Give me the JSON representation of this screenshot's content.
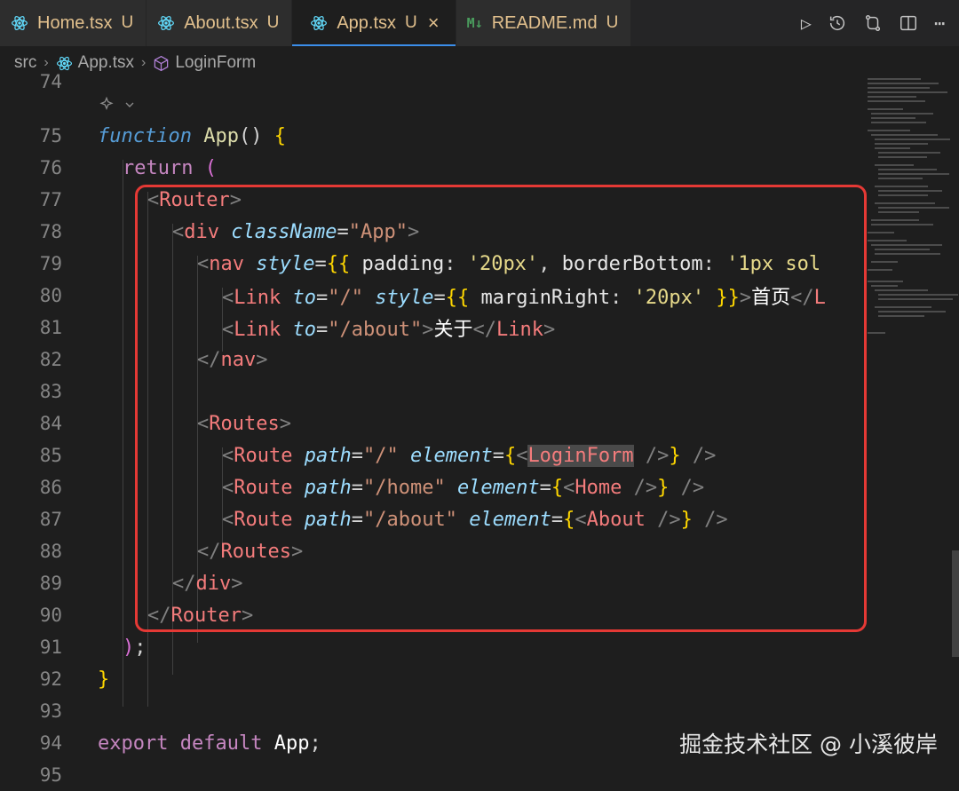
{
  "tabs": [
    {
      "name": "Home.tsx",
      "status": "U",
      "icon": "react-icon",
      "active": false
    },
    {
      "name": "About.tsx",
      "status": "U",
      "icon": "react-icon",
      "active": false
    },
    {
      "name": "App.tsx",
      "status": "U",
      "icon": "react-icon",
      "active": true,
      "close": "×"
    },
    {
      "name": "README.md",
      "status": "U",
      "icon": "markdown-icon",
      "active": false
    }
  ],
  "markdown_icon_text": "M↓",
  "toolbar": {
    "run": "▷",
    "timeline": "history-icon",
    "compare": "compare-icon",
    "split": "split-editor-icon",
    "more": "⋯"
  },
  "breadcrumb": {
    "folder": "src",
    "file": "App.tsx",
    "symbol": "LoginForm",
    "sep": "›"
  },
  "lines": {
    "top_partial": "74",
    "n75": "75",
    "n76": "76",
    "n77": "77",
    "n78": "78",
    "n79": "79",
    "n80": "80",
    "n81": "81",
    "n82": "82",
    "n83": "83",
    "n84": "84",
    "n85": "85",
    "n86": "86",
    "n87": "87",
    "n88": "88",
    "n89": "89",
    "n90": "90",
    "n91": "91",
    "n92": "92",
    "n93": "93",
    "n94": "94",
    "n95": "95"
  },
  "code": {
    "l75": {
      "kw": "function",
      "name": "App",
      "rest": "() ",
      "brace": "{"
    },
    "l76": {
      "kw": "return",
      "paren": "("
    },
    "l77": {
      "open": "<",
      "tag": "Router",
      "close": ">"
    },
    "l78": {
      "open": "<",
      "tag": "div",
      "attr": "className",
      "eq": "=",
      "val": "\"App\"",
      "close": ">"
    },
    "l79": {
      "open": "<",
      "tag": "nav",
      "attr": "style",
      "eq": "=",
      "brace": "{{",
      "k1": " padding",
      "c1": ": ",
      "v1": "'20px'",
      "comma": ", ",
      "k2": "borderBottom",
      "c2": ": ",
      "v2": "'1px sol"
    },
    "l80": {
      "open": "<",
      "tag": "Link",
      "attr1": "to",
      "eq": "=",
      "v1": "\"/\"",
      "attr2": "style",
      "brace": "{{",
      "k": " marginRight",
      "c": ": ",
      "v": "'20px'",
      "bclose": " }}",
      "gt": ">",
      "text": "首页",
      "endopen": "</",
      "endtag": "L"
    },
    "l81": {
      "open": "<",
      "tag": "Link",
      "attr": "to",
      "eq": "=",
      "v": "\"/about\"",
      "gt": ">",
      "text": "关于",
      "endopen": "</",
      "endtag": "Link",
      "endgt": ">"
    },
    "l82": {
      "open": "</",
      "tag": "nav",
      "close": ">"
    },
    "l84": {
      "open": "<",
      "tag": "Routes",
      "close": ">"
    },
    "l85": {
      "open": "<",
      "tag": "Route",
      "a1": "path",
      "eq": "=",
      "v1": "\"/\"",
      "a2": "element",
      "br": "{",
      "lt": "<",
      "comp": "LoginForm",
      "selfclose": " />",
      "brc": "}",
      "end": " />"
    },
    "l86": {
      "open": "<",
      "tag": "Route",
      "a1": "path",
      "eq": "=",
      "v1": "\"/home\"",
      "a2": "element",
      "br": "{",
      "lt": "<",
      "comp": "Home",
      "selfclose": " />",
      "brc": "}",
      "end": " />"
    },
    "l87": {
      "open": "<",
      "tag": "Route",
      "a1": "path",
      "eq": "=",
      "v1": "\"/about\"",
      "a2": "element",
      "br": "{",
      "lt": "<",
      "comp": "About",
      "selfclose": " />",
      "brc": "}",
      "end": " />"
    },
    "l88": {
      "open": "</",
      "tag": "Routes",
      "close": ">"
    },
    "l89": {
      "open": "</",
      "tag": "div",
      "close": ">"
    },
    "l90": {
      "open": "</",
      "tag": "Router",
      "close": ">"
    },
    "l91": {
      "paren": ")",
      "semi": ";"
    },
    "l92": {
      "brace": "}"
    },
    "l94": {
      "kw1": "export",
      "kw2": "default",
      "name": "App",
      "semi": ";"
    }
  },
  "watermark": "掘金技术社区 @ 小溪彼岸",
  "colors": {
    "accent": "#3b8eea",
    "annotation": "#e53935",
    "modified": "#e2c08d"
  }
}
